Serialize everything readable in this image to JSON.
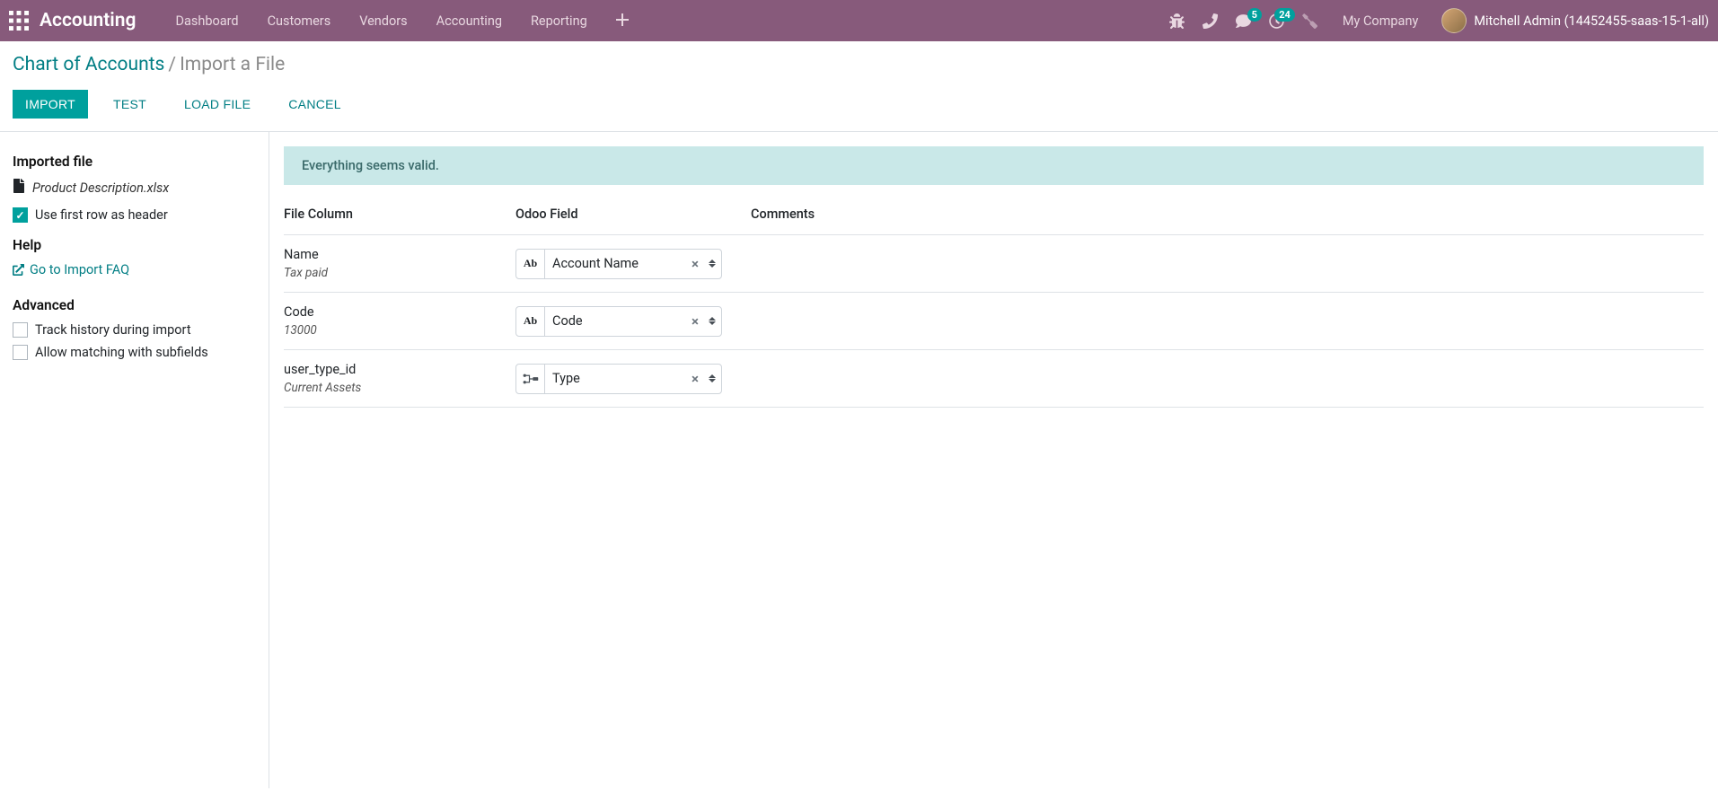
{
  "navbar": {
    "brand": "Accounting",
    "menu": [
      "Dashboard",
      "Customers",
      "Vendors",
      "Accounting",
      "Reporting"
    ],
    "messages_badge": "5",
    "activities_badge": "24",
    "company": "My Company",
    "username": "Mitchell Admin (14452455-saas-15-1-all)"
  },
  "breadcrumb": {
    "parent": "Chart of Accounts",
    "current": "Import a File"
  },
  "buttons": {
    "import": "IMPORT",
    "test": "TEST",
    "load_file": "LOAD FILE",
    "cancel": "CANCEL"
  },
  "sidebar": {
    "imported_file_heading": "Imported file",
    "filename": "Product Description.xlsx",
    "first_row_header_label": "Use first row as header",
    "first_row_header_checked": true,
    "help_heading": "Help",
    "faq_link": "Go to Import FAQ",
    "advanced_heading": "Advanced",
    "track_history_label": "Track history during import",
    "allow_subfields_label": "Allow matching with subfields"
  },
  "alert": {
    "message": "Everything seems valid."
  },
  "mapping_header": {
    "file_column": "File Column",
    "odoo_field": "Odoo Field",
    "comments": "Comments"
  },
  "mappings": [
    {
      "column_name": "Name",
      "preview": "Tax paid",
      "field_type": "char",
      "field_label": "Account Name"
    },
    {
      "column_name": "Code",
      "preview": "13000",
      "field_type": "char",
      "field_label": "Code"
    },
    {
      "column_name": "user_type_id",
      "preview": "Current Assets",
      "field_type": "relation",
      "field_label": "Type"
    }
  ]
}
